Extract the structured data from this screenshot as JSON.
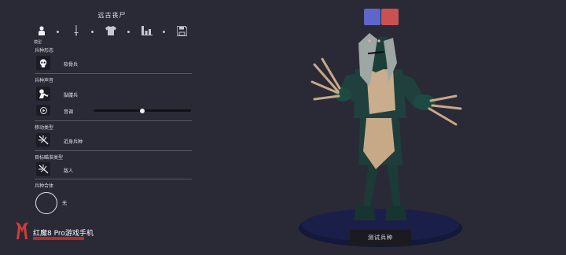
{
  "header": {
    "title": "远古丧尸"
  },
  "steps": {
    "items": [
      {
        "name": "body-icon"
      },
      {
        "name": "sword-icon"
      },
      {
        "name": "shirt-icon"
      },
      {
        "name": "stats-icon"
      },
      {
        "name": "save-icon"
      }
    ],
    "active_label": "模型"
  },
  "sections": {
    "form": {
      "label": "兵种形态",
      "value": "软骨兵",
      "icon": "skull-icon"
    },
    "voice": {
      "label": "兵种声音",
      "value": "骷髅兵",
      "icon": "skeleton-icon",
      "pitch_label": "音调",
      "pitch_value": 0.5
    },
    "movement": {
      "label": "移动类型",
      "value": "近身兵种",
      "icon": "crossbow-icon"
    },
    "target": {
      "label": "目标瞄准类型",
      "value": "敌人",
      "icon": "crossbow-icon"
    },
    "combine": {
      "label": "兵种合体",
      "value": "无"
    }
  },
  "colors": {
    "primary_swatch": "#5f66c9",
    "secondary_swatch": "#c85252",
    "background": "#2a2936"
  },
  "buttons": {
    "test_unit": "测试兵种"
  },
  "watermark": {
    "text": "红魔8 Pro游戏手机"
  }
}
